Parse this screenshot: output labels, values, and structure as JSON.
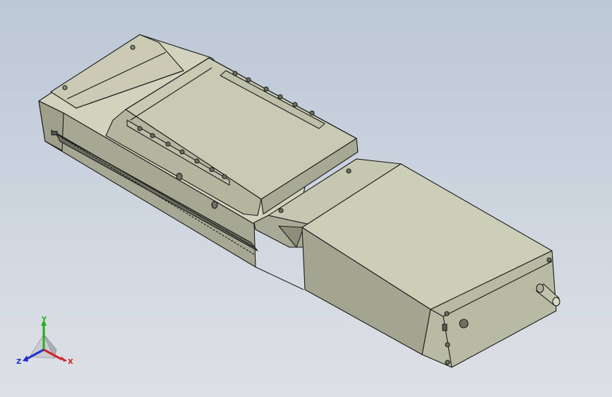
{
  "viewport": {
    "background_top": "#bdc8d6",
    "background_bottom": "#dde1e6",
    "model": "linear-actuator-module",
    "body_color": "#c3c4ac",
    "edge_color": "#1a1a1a"
  },
  "triad": {
    "x_label": "X",
    "y_label": "Y",
    "z_label": "Z",
    "x_color": "#d42020",
    "y_color": "#20b020",
    "z_color": "#2030d0"
  }
}
